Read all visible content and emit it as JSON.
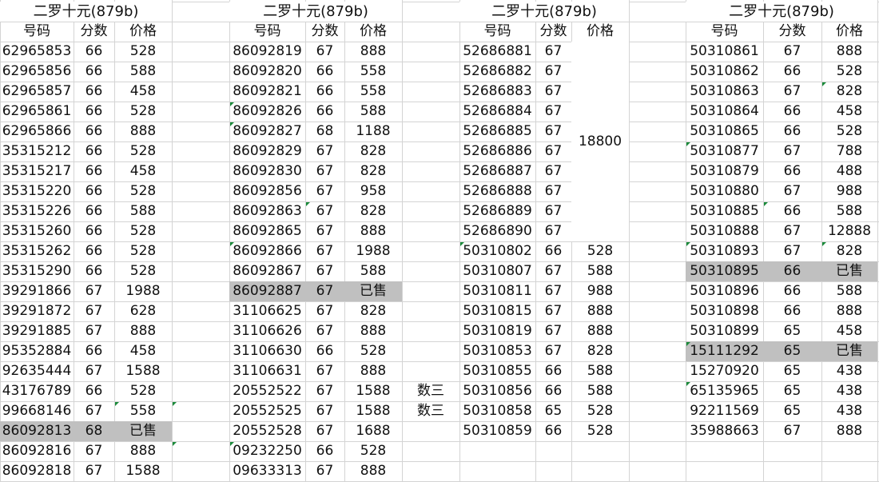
{
  "blocks": [
    {
      "title": "二罗十元(879b)",
      "headers": [
        "号码",
        "分数",
        "价格"
      ],
      "rows": [
        [
          "62965853",
          "66",
          "528"
        ],
        [
          "62965856",
          "66",
          "588"
        ],
        [
          "62965857",
          "66",
          "458"
        ],
        [
          "62965861",
          "66",
          "528"
        ],
        [
          "62965866",
          "66",
          "888"
        ],
        [
          "35315212",
          "66",
          "528"
        ],
        [
          "35315217",
          "66",
          "458"
        ],
        [
          "35315220",
          "66",
          "528"
        ],
        [
          "35315226",
          "66",
          "588"
        ],
        [
          "35315260",
          "66",
          "528"
        ],
        [
          "35315262",
          "66",
          "528"
        ],
        [
          "35315290",
          "66",
          "528"
        ],
        [
          "39291866",
          "67",
          "1988"
        ],
        [
          "39291872",
          "67",
          "628"
        ],
        [
          "39291885",
          "67",
          "888"
        ],
        [
          "95352884",
          "66",
          "458"
        ],
        [
          "92635444",
          "67",
          "1588"
        ],
        [
          "43176789",
          "66",
          "528"
        ],
        [
          "99668146",
          "67",
          "558"
        ],
        [
          "86092813",
          "68",
          "已售"
        ],
        [
          "86092816",
          "67",
          "888"
        ],
        [
          "86092818",
          "67",
          "1588"
        ]
      ]
    },
    {
      "title": "二罗十元(879b)",
      "headers": [
        "号码",
        "分数",
        "价格"
      ],
      "rows": [
        [
          "86092819",
          "67",
          "888"
        ],
        [
          "86092820",
          "66",
          "558"
        ],
        [
          "86092821",
          "66",
          "558"
        ],
        [
          "86092826",
          "66",
          "588"
        ],
        [
          "86092827",
          "68",
          "1188"
        ],
        [
          "86092829",
          "67",
          "828"
        ],
        [
          "86092830",
          "67",
          "828"
        ],
        [
          "86092856",
          "67",
          "958"
        ],
        [
          "86092863",
          "67",
          "828"
        ],
        [
          "86092865",
          "67",
          "888"
        ],
        [
          "86092866",
          "67",
          "1988"
        ],
        [
          "86092867",
          "67",
          "588"
        ],
        [
          "86092887",
          "67",
          "已售"
        ],
        [
          "31106625",
          "67",
          "828"
        ],
        [
          "31106626",
          "67",
          "888"
        ],
        [
          "31106630",
          "66",
          "528"
        ],
        [
          "31106631",
          "67",
          "888"
        ],
        [
          "20552522",
          "67",
          "1588"
        ],
        [
          "20552525",
          "67",
          "1588"
        ],
        [
          "20552528",
          "67",
          "1688"
        ],
        [
          "09232250",
          "66",
          "528"
        ],
        [
          "09633313",
          "67",
          "888"
        ]
      ]
    },
    {
      "title": "二罗十元(879b)",
      "headers": [
        "号码",
        "分数",
        "价格"
      ],
      "rows": [
        [
          "52686881",
          "67",
          ""
        ],
        [
          "52686882",
          "67",
          ""
        ],
        [
          "52686883",
          "67",
          ""
        ],
        [
          "52686884",
          "67",
          ""
        ],
        [
          "52686885",
          "67",
          ""
        ],
        [
          "52686886",
          "67",
          ""
        ],
        [
          "52686887",
          "67",
          ""
        ],
        [
          "52686888",
          "67",
          ""
        ],
        [
          "52686889",
          "67",
          ""
        ],
        [
          "52686890",
          "67",
          ""
        ],
        [
          "50310802",
          "66",
          "528"
        ],
        [
          "50310807",
          "67",
          "588"
        ],
        [
          "50310811",
          "67",
          "988"
        ],
        [
          "50310815",
          "67",
          "888"
        ],
        [
          "50310819",
          "67",
          "888"
        ],
        [
          "50310853",
          "67",
          "828"
        ],
        [
          "50310855",
          "66",
          "588"
        ],
        [
          "50310856",
          "66",
          "588"
        ],
        [
          "50310858",
          "65",
          "528"
        ],
        [
          "50310859",
          "66",
          "528"
        ]
      ],
      "merged_price": "18800"
    },
    {
      "title": "二罗十元(879b)",
      "headers": [
        "号码",
        "分数",
        "价格"
      ],
      "rows": [
        [
          "50310861",
          "67",
          "888"
        ],
        [
          "50310862",
          "66",
          "528"
        ],
        [
          "50310863",
          "67",
          "828"
        ],
        [
          "50310864",
          "66",
          "458"
        ],
        [
          "50310865",
          "66",
          "528"
        ],
        [
          "50310877",
          "67",
          "788"
        ],
        [
          "50310879",
          "66",
          "488"
        ],
        [
          "50310880",
          "67",
          "988"
        ],
        [
          "50310885",
          "66",
          "588"
        ],
        [
          "50310888",
          "67",
          "12888"
        ],
        [
          "50310893",
          "67",
          "828"
        ],
        [
          "50310895",
          "66",
          "已售"
        ],
        [
          "50310896",
          "66",
          "588"
        ],
        [
          "50310898",
          "66",
          "888"
        ],
        [
          "50310899",
          "65",
          "458"
        ],
        [
          "15111292",
          "65",
          "已售"
        ],
        [
          "15270920",
          "65",
          "438"
        ],
        [
          "65135965",
          "65",
          "438"
        ],
        [
          "92211569",
          "65",
          "438"
        ],
        [
          "35988663",
          "67",
          "888"
        ]
      ]
    }
  ],
  "side_notes": [
    "数三",
    "数三"
  ],
  "colors": {
    "grid": "#d4d4d4",
    "sold_fill": "#c0c0c0",
    "marker": "#1a8a3a"
  }
}
